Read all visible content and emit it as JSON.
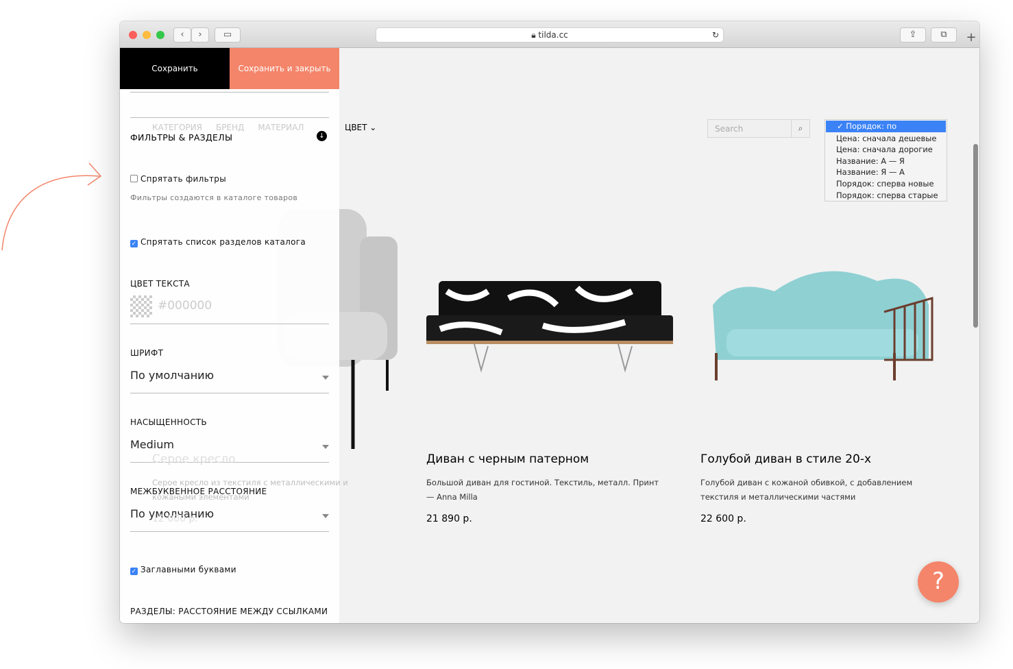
{
  "browser": {
    "url": "tilda.cc"
  },
  "editor": {
    "save": "Сохранить",
    "save_close": "Сохранить и закрыть",
    "section_title": "ФИЛЬТРЫ & РАЗДЕЛЫ",
    "hide_filters": "Спрятать фильтры",
    "filters_hint": "Фильтры создаются в каталоге товаров",
    "hide_sections": "Спрятать список разделов каталога",
    "text_color_label": "ЦВЕТ ТЕКСТА",
    "text_color_placeholder": "#000000",
    "font_label": "ШРИФТ",
    "font_value": "По умолчанию",
    "weight_label": "НАСЫЩЕННОСТЬ",
    "weight_value": "Medium",
    "spacing_label": "МЕЖБУКВЕННОЕ РАССТОЯНИЕ",
    "spacing_value": "По умолчанию",
    "uppercase": "Заглавными буквами",
    "links_spacing_label": "РАЗДЕЛЫ: РАССТОЯНИЕ МЕЖДУ ССЫЛКАМИ"
  },
  "filters": [
    "КАТЕГОРИЯ",
    "БРЕНД",
    "МАТЕРИАЛ",
    "ЦВЕТ"
  ],
  "search": {
    "placeholder": "Search"
  },
  "sort_options": [
    "Порядок: по умолчанию",
    "Цена: сначала дешевые",
    "Цена: сначала дорогие",
    "Название: А — Я",
    "Название: Я — А",
    "Порядок: сперва новые",
    "Порядок: сперва старые"
  ],
  "products": [
    {
      "title": "Серое кресло",
      "desc": "Серое кресло из текстиля с металлическими и кожаными элементами",
      "price": "12 000 р."
    },
    {
      "title": "Диван с черным патерном",
      "desc": "Большой диван для гостиной. Текстиль, металл. Принт — Anna Milla",
      "price": "21 890 р."
    },
    {
      "title": "Голубой диван в стиле 20-х",
      "desc": "Голубой диван с кожаной обивкой, с добавлением текстиля и металлическими частями",
      "price": "22 600 р."
    }
  ],
  "help": "?",
  "colors": {
    "accent": "#f4856a",
    "select": "#3b82f6"
  }
}
